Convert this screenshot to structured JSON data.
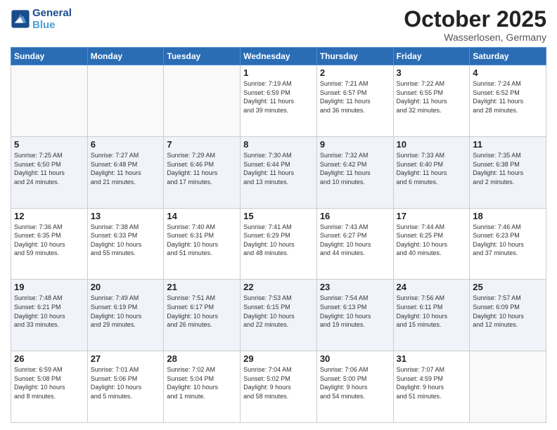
{
  "header": {
    "logo_line1": "General",
    "logo_line2": "Blue",
    "month": "October 2025",
    "location": "Wasserlosen, Germany"
  },
  "days_of_week": [
    "Sunday",
    "Monday",
    "Tuesday",
    "Wednesday",
    "Thursday",
    "Friday",
    "Saturday"
  ],
  "weeks": [
    [
      {
        "day": "",
        "info": ""
      },
      {
        "day": "",
        "info": ""
      },
      {
        "day": "",
        "info": ""
      },
      {
        "day": "1",
        "info": "Sunrise: 7:19 AM\nSunset: 6:59 PM\nDaylight: 11 hours\nand 39 minutes."
      },
      {
        "day": "2",
        "info": "Sunrise: 7:21 AM\nSunset: 6:57 PM\nDaylight: 11 hours\nand 36 minutes."
      },
      {
        "day": "3",
        "info": "Sunrise: 7:22 AM\nSunset: 6:55 PM\nDaylight: 11 hours\nand 32 minutes."
      },
      {
        "day": "4",
        "info": "Sunrise: 7:24 AM\nSunset: 6:52 PM\nDaylight: 11 hours\nand 28 minutes."
      }
    ],
    [
      {
        "day": "5",
        "info": "Sunrise: 7:25 AM\nSunset: 6:50 PM\nDaylight: 11 hours\nand 24 minutes."
      },
      {
        "day": "6",
        "info": "Sunrise: 7:27 AM\nSunset: 6:48 PM\nDaylight: 11 hours\nand 21 minutes."
      },
      {
        "day": "7",
        "info": "Sunrise: 7:29 AM\nSunset: 6:46 PM\nDaylight: 11 hours\nand 17 minutes."
      },
      {
        "day": "8",
        "info": "Sunrise: 7:30 AM\nSunset: 6:44 PM\nDaylight: 11 hours\nand 13 minutes."
      },
      {
        "day": "9",
        "info": "Sunrise: 7:32 AM\nSunset: 6:42 PM\nDaylight: 11 hours\nand 10 minutes."
      },
      {
        "day": "10",
        "info": "Sunrise: 7:33 AM\nSunset: 6:40 PM\nDaylight: 11 hours\nand 6 minutes."
      },
      {
        "day": "11",
        "info": "Sunrise: 7:35 AM\nSunset: 6:38 PM\nDaylight: 11 hours\nand 2 minutes."
      }
    ],
    [
      {
        "day": "12",
        "info": "Sunrise: 7:36 AM\nSunset: 6:35 PM\nDaylight: 10 hours\nand 59 minutes."
      },
      {
        "day": "13",
        "info": "Sunrise: 7:38 AM\nSunset: 6:33 PM\nDaylight: 10 hours\nand 55 minutes."
      },
      {
        "day": "14",
        "info": "Sunrise: 7:40 AM\nSunset: 6:31 PM\nDaylight: 10 hours\nand 51 minutes."
      },
      {
        "day": "15",
        "info": "Sunrise: 7:41 AM\nSunset: 6:29 PM\nDaylight: 10 hours\nand 48 minutes."
      },
      {
        "day": "16",
        "info": "Sunrise: 7:43 AM\nSunset: 6:27 PM\nDaylight: 10 hours\nand 44 minutes."
      },
      {
        "day": "17",
        "info": "Sunrise: 7:44 AM\nSunset: 6:25 PM\nDaylight: 10 hours\nand 40 minutes."
      },
      {
        "day": "18",
        "info": "Sunrise: 7:46 AM\nSunset: 6:23 PM\nDaylight: 10 hours\nand 37 minutes."
      }
    ],
    [
      {
        "day": "19",
        "info": "Sunrise: 7:48 AM\nSunset: 6:21 PM\nDaylight: 10 hours\nand 33 minutes."
      },
      {
        "day": "20",
        "info": "Sunrise: 7:49 AM\nSunset: 6:19 PM\nDaylight: 10 hours\nand 29 minutes."
      },
      {
        "day": "21",
        "info": "Sunrise: 7:51 AM\nSunset: 6:17 PM\nDaylight: 10 hours\nand 26 minutes."
      },
      {
        "day": "22",
        "info": "Sunrise: 7:53 AM\nSunset: 6:15 PM\nDaylight: 10 hours\nand 22 minutes."
      },
      {
        "day": "23",
        "info": "Sunrise: 7:54 AM\nSunset: 6:13 PM\nDaylight: 10 hours\nand 19 minutes."
      },
      {
        "day": "24",
        "info": "Sunrise: 7:56 AM\nSunset: 6:11 PM\nDaylight: 10 hours\nand 15 minutes."
      },
      {
        "day": "25",
        "info": "Sunrise: 7:57 AM\nSunset: 6:09 PM\nDaylight: 10 hours\nand 12 minutes."
      }
    ],
    [
      {
        "day": "26",
        "info": "Sunrise: 6:59 AM\nSunset: 5:08 PM\nDaylight: 10 hours\nand 8 minutes."
      },
      {
        "day": "27",
        "info": "Sunrise: 7:01 AM\nSunset: 5:06 PM\nDaylight: 10 hours\nand 5 minutes."
      },
      {
        "day": "28",
        "info": "Sunrise: 7:02 AM\nSunset: 5:04 PM\nDaylight: 10 hours\nand 1 minute."
      },
      {
        "day": "29",
        "info": "Sunrise: 7:04 AM\nSunset: 5:02 PM\nDaylight: 9 hours\nand 58 minutes."
      },
      {
        "day": "30",
        "info": "Sunrise: 7:06 AM\nSunset: 5:00 PM\nDaylight: 9 hours\nand 54 minutes."
      },
      {
        "day": "31",
        "info": "Sunrise: 7:07 AM\nSunset: 4:59 PM\nDaylight: 9 hours\nand 51 minutes."
      },
      {
        "day": "",
        "info": ""
      }
    ]
  ]
}
